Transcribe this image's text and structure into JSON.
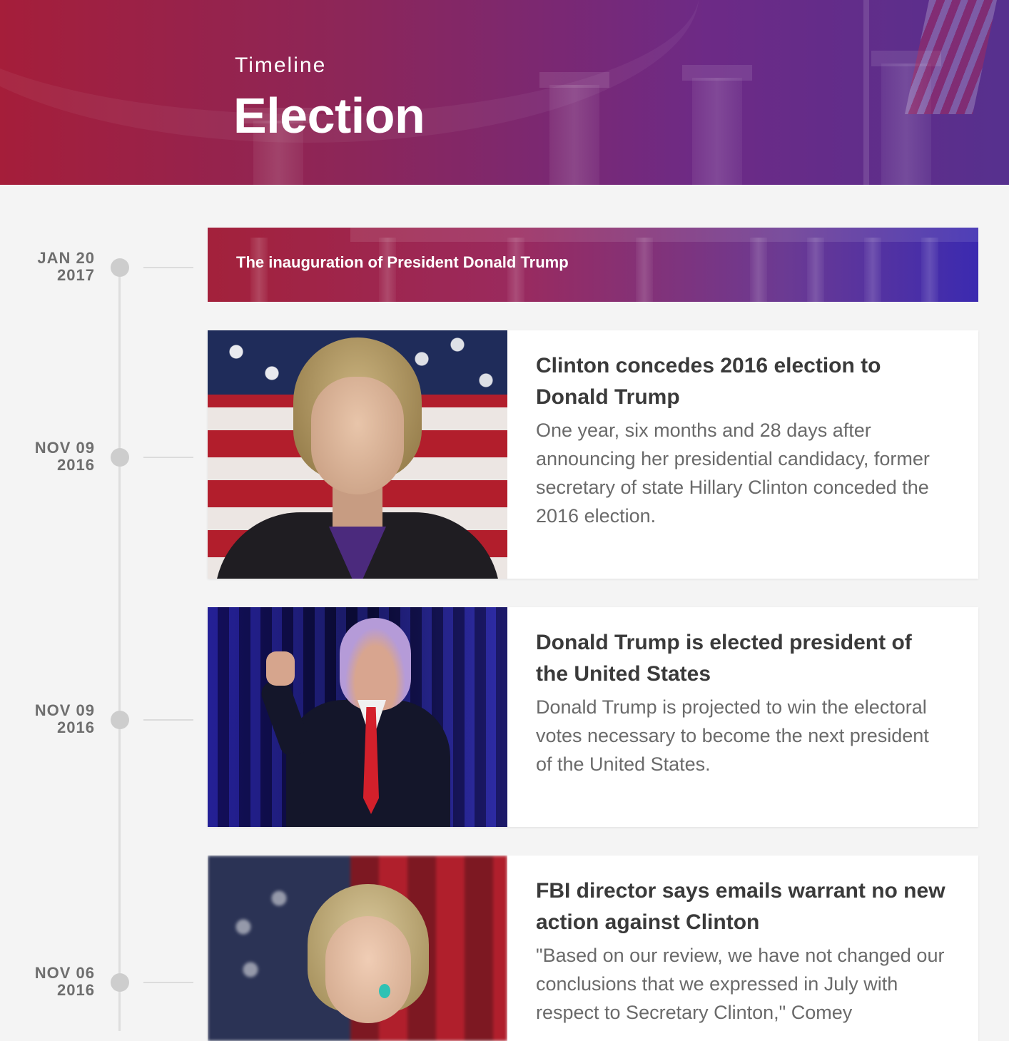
{
  "header": {
    "eyebrow": "Timeline",
    "title": "Election"
  },
  "banner": {
    "title": "The inauguration of President Donald Trump"
  },
  "timeline": [
    {
      "month_day": "JAN 20",
      "year": "2017"
    },
    {
      "month_day": "NOV 09",
      "year": "2016"
    },
    {
      "month_day": "NOV 09",
      "year": "2016"
    },
    {
      "month_day": "NOV 06",
      "year": "2016"
    }
  ],
  "stories": [
    {
      "title": "Clinton concedes 2016 election to Donald Trump",
      "text": "One year, six months and 28 days after announcing her presidential candidacy, former secretary of state Hillary Clinton conceded the 2016 election."
    },
    {
      "title": "Donald Trump is elected president of the United States",
      "text": "Donald Trump is projected to win the electoral votes necessary to become the next president of the United States."
    },
    {
      "title": "FBI director says emails warrant no new action against Clinton",
      "text": "\"Based on our review, we have not changed our conclusions that we expressed in July with respect to Secretary Clinton,\" Comey"
    }
  ],
  "colors": {
    "header_start": "#a51e3a",
    "header_end": "#56308e",
    "page_bg": "#f4f4f4",
    "title_text": "#3a3a3a",
    "body_text": "#6a6a6a",
    "date_text": "#6e6e6e"
  }
}
